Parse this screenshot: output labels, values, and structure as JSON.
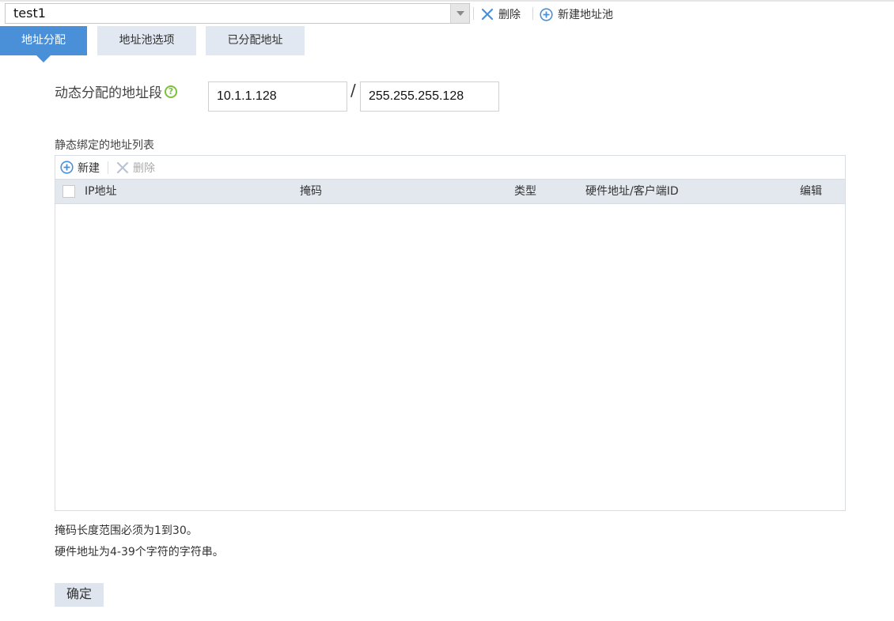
{
  "pool_selector": {
    "value": "test1"
  },
  "toolbar": {
    "delete_label": "删除",
    "new_pool_label": "新建地址池"
  },
  "tabs": [
    {
      "label": "地址分配",
      "active": true
    },
    {
      "label": "地址池选项",
      "active": false
    },
    {
      "label": "已分配地址",
      "active": false
    }
  ],
  "dynamic_range": {
    "label": "动态分配的地址段",
    "help_icon": "question-circle-icon",
    "ip": "10.1.1.128",
    "separator": "/",
    "mask": "255.255.255.128"
  },
  "static_list": {
    "title": "静态绑定的地址列表",
    "new_label": "新建",
    "delete_label": "删除",
    "columns": [
      "IP地址",
      "掩码",
      "类型",
      "硬件地址/客户端ID",
      "编辑"
    ],
    "rows": []
  },
  "notes": [
    "掩码长度范围必须为1到30。",
    "硬件地址为4-39个字符的字符串。"
  ],
  "confirm_label": "确定",
  "colors": {
    "accent": "#4a90d9",
    "tab_inactive": "#e1e8f2",
    "help_green": "#7cc13b",
    "delete_icon": "#4a90d9",
    "disabled": "#b8c4d4"
  }
}
